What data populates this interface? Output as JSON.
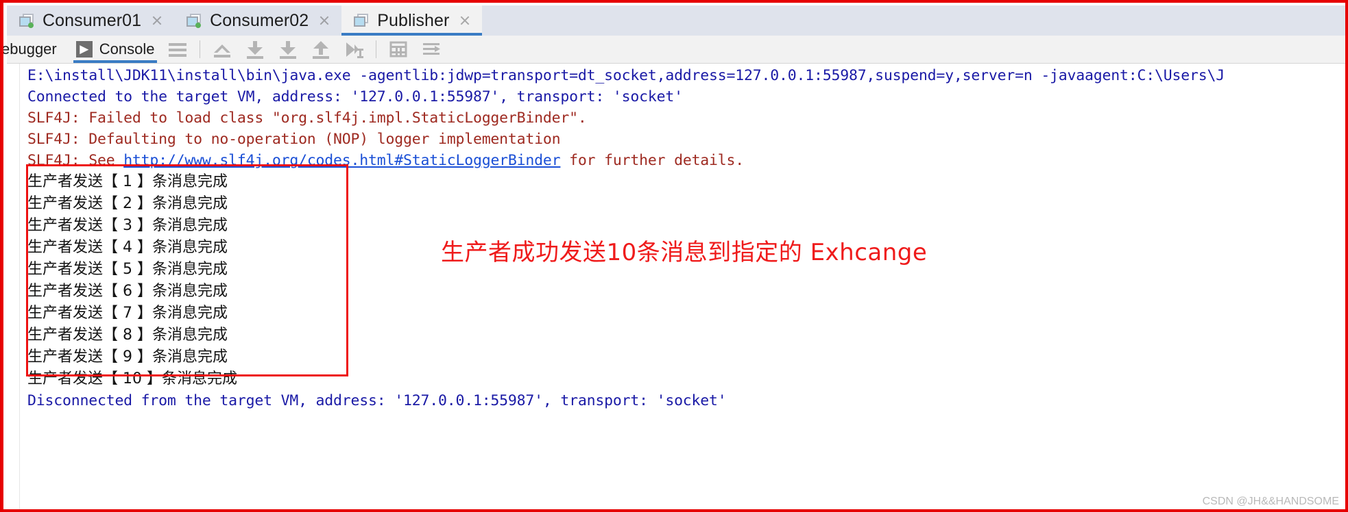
{
  "window": {
    "annotation_border_color": "#e60000"
  },
  "tabs": [
    {
      "label": "Consumer01",
      "icon": "run-config-icon",
      "running": true,
      "active": false,
      "close_icon": "close-icon"
    },
    {
      "label": "Consumer02",
      "icon": "run-config-icon",
      "running": true,
      "active": false,
      "close_icon": "close-icon"
    },
    {
      "label": "Publisher",
      "icon": "run-config-icon",
      "running": false,
      "active": true,
      "close_icon": "close-icon"
    }
  ],
  "toolbar": {
    "debugger_label": "ebugger",
    "console_label": "Console",
    "console_badge": "▶",
    "icons": [
      {
        "name": "hamburger-icon"
      },
      {
        "name": "step-out-of-icon"
      },
      {
        "name": "step-into-icon"
      },
      {
        "name": "force-step-into-icon"
      },
      {
        "name": "step-out-icon"
      },
      {
        "name": "run-to-cursor-icon"
      },
      {
        "name": "table-view-icon"
      },
      {
        "name": "soft-wrap-icon"
      }
    ]
  },
  "console": {
    "lines": [
      {
        "type": "plain",
        "color": "blue",
        "text": "E:\\install\\JDK11\\install\\bin\\java.exe -agentlib:jdwp=transport=dt_socket,address=127.0.0.1:55987,suspend=y,server=n -javaagent:C:\\Users\\J"
      },
      {
        "type": "plain",
        "color": "blue",
        "text": "Connected to the target VM, address: '127.0.0.1:55987', transport: 'socket'"
      },
      {
        "type": "plain",
        "color": "red",
        "text": "SLF4J: Failed to load class \"org.slf4j.impl.StaticLoggerBinder\"."
      },
      {
        "type": "plain",
        "color": "red",
        "text": "SLF4J: Defaulting to no-operation (NOP) logger implementation"
      },
      {
        "type": "link",
        "color": "red",
        "prefix": "SLF4J: See ",
        "link_text": "http://www.slf4j.org/codes.html#StaticLoggerBinder",
        "suffix": " for further details."
      }
    ],
    "producer_lines": [
      "生产者发送【 1 】条消息完成",
      "生产者发送【 2 】条消息完成",
      "生产者发送【 3 】条消息完成",
      "生产者发送【 4 】条消息完成",
      "生产者发送【 5 】条消息完成",
      "生产者发送【 6 】条消息完成",
      "生产者发送【 7 】条消息完成",
      "生产者发送【 8 】条消息完成",
      "生产者发送【 9 】条消息完成",
      "生产者发送【 10 】条消息完成"
    ],
    "disconnect_line": "Disconnected from the target VM, address: '127.0.0.1:55987', transport: 'socket'"
  },
  "annotation": {
    "text": "生产者成功发送10条消息到指定的 Exhcange",
    "color": "#ef1b1b"
  },
  "watermark": {
    "text": "CSDN @JH&&HANDSOME"
  }
}
